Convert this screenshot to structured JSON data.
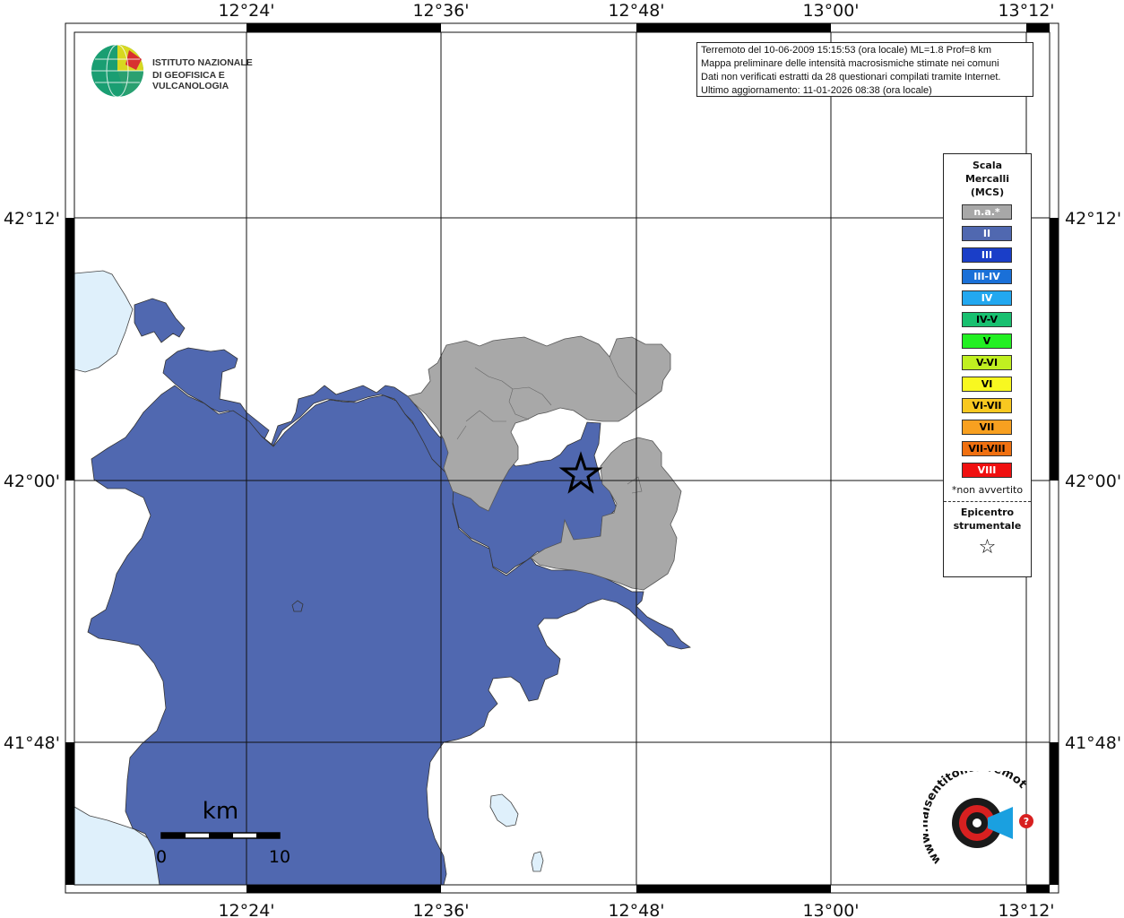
{
  "map": {
    "lon_ticks": [
      "12°24'",
      "12°36'",
      "12°48'",
      "13°00'",
      "13°12'"
    ],
    "lat_ticks": [
      "42°12'",
      "42°00'",
      "41°48'"
    ],
    "colors": {
      "land_intensity_II": "#5068b0",
      "not_available": "#a8a8a8",
      "water": "#dff0fb",
      "grid": "#111111"
    }
  },
  "info": {
    "line1": "Terremoto del 10-06-2009 15:15:53 (ora locale) ML=1.8 Prof=8 km",
    "line2": "Mappa preliminare delle intensità macrosismiche stimate nei comuni",
    "line3": "Dati non verificati estratti da 28 questionari compilati tramite Internet.",
    "line4": "Ultimo aggiornamento: 11-01-2026 08:38 (ora locale)"
  },
  "logo": {
    "line1": "ISTITUTO NAZIONALE",
    "line2": "DI GEOFISICA E VULCANOLOGIA"
  },
  "legend": {
    "title1": "Scala",
    "title2": "Mercalli",
    "title3": "(MCS)",
    "items": [
      {
        "label": "n.a.*",
        "color": "#a8a8a8",
        "text": "#ffffff"
      },
      {
        "label": "II",
        "color": "#5068b0",
        "text": "#ffffff"
      },
      {
        "label": "III",
        "color": "#1a3ec8",
        "text": "#ffffff"
      },
      {
        "label": "III-IV",
        "color": "#1a70d8",
        "text": "#ffffff"
      },
      {
        "label": "IV",
        "color": "#22a8f0",
        "text": "#ffffff"
      },
      {
        "label": "IV-V",
        "color": "#18c070",
        "text": "#000000"
      },
      {
        "label": "V",
        "color": "#22f022",
        "text": "#000000"
      },
      {
        "label": "V-VI",
        "color": "#c0f020",
        "text": "#000000"
      },
      {
        "label": "VI",
        "color": "#f8f820",
        "text": "#000000"
      },
      {
        "label": "VI-VII",
        "color": "#f8c820",
        "text": "#000000"
      },
      {
        "label": "VII",
        "color": "#f8a020",
        "text": "#000000"
      },
      {
        "label": "VII-VIII",
        "color": "#f07010",
        "text": "#000000"
      },
      {
        "label": "VIII",
        "color": "#f01010",
        "text": "#ffffff"
      }
    ],
    "note": "*non avvertito",
    "epi1": "Epicentro",
    "epi2": "strumentale",
    "star": "☆"
  },
  "scalebar": {
    "unit": "km",
    "min": "0",
    "max": "10"
  },
  "hst_logo": {
    "text": "www.haisentitoilterremoto.it"
  }
}
